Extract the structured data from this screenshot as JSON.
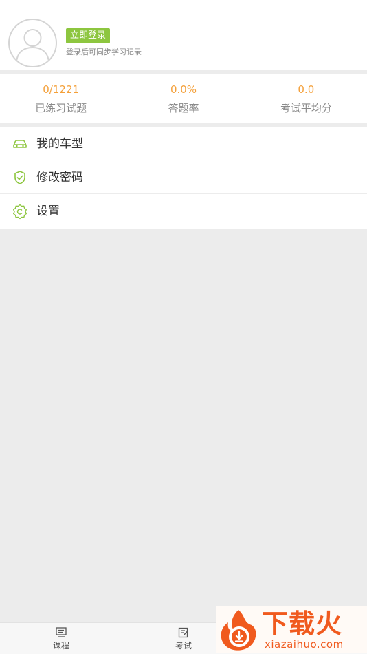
{
  "profile": {
    "login_button": "立即登录",
    "login_hint": "登录后可同步学习记录",
    "avatar_icon": "user-avatar-icon"
  },
  "stats": [
    {
      "value": "0/1221",
      "label": "已练习试题"
    },
    {
      "value": "0.0%",
      "label": "答题率"
    },
    {
      "value": "0.0",
      "label": "考试平均分"
    }
  ],
  "menu": {
    "items": [
      {
        "label": "我的车型",
        "icon": "car-icon"
      },
      {
        "label": "修改密码",
        "icon": "shield-check-icon"
      },
      {
        "label": "设置",
        "icon": "gear-icon"
      }
    ]
  },
  "bottom_nav": {
    "items": [
      {
        "label": "课程",
        "icon": "course-icon"
      },
      {
        "label": "考试",
        "icon": "exam-icon"
      }
    ]
  },
  "watermark": {
    "brand": "下载火",
    "url": "xiazaihuo.com"
  },
  "colors": {
    "accent_green": "#8dc63f",
    "stat_orange": "#f4a03a",
    "background": "#ececec",
    "watermark_orange": "#f05a1e"
  }
}
